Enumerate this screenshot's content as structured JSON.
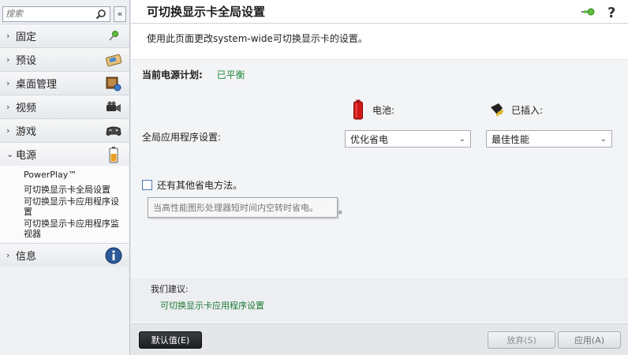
{
  "search": {
    "placeholder": "搜索"
  },
  "sidebar": {
    "items": [
      {
        "label": "固定",
        "icon": "pin-icon"
      },
      {
        "label": "预设",
        "icon": "presets-icon"
      },
      {
        "label": "桌面管理",
        "icon": "desktop-management-icon"
      },
      {
        "label": "视频",
        "icon": "video-camera-icon"
      },
      {
        "label": "游戏",
        "icon": "gamepad-icon"
      },
      {
        "label": "电源",
        "icon": "battery-icon"
      },
      {
        "label": "信息",
        "icon": "info-icon"
      }
    ],
    "power_subitems": [
      "PowerPlay™",
      "可切换显示卡全局设置",
      "可切换显示卡应用程序设置",
      "可切换显示卡应用程序监视器"
    ]
  },
  "header": {
    "title": "可切换显示卡全局设置"
  },
  "description": "使用此页面更改system-wide可切换显示卡的设置。",
  "power_plan": {
    "label": "当前电源计划:",
    "value": "已平衡"
  },
  "columns": {
    "battery": "电池:",
    "plugged": "已插入:"
  },
  "global_setting": {
    "label": "全局应用程序设置:",
    "battery_value": "优化省电",
    "plugged_value": "最佳性能"
  },
  "other_methods": {
    "label": "还有其他省电方法。"
  },
  "tooltip": {
    "text": "当高性能图形处理器短时间内空转时省电。",
    "tail": "。"
  },
  "recommend": {
    "label": "我们建议:",
    "link": "可切换显示卡应用程序设置"
  },
  "footer": {
    "default_label": "默认值(E)",
    "discard_label": "放弃(S)",
    "apply_label": "应用(A)"
  },
  "colors": {
    "accent_green": "#1f8a3a",
    "link_green": "#1f7a36",
    "default_button": "#1c1e21"
  }
}
